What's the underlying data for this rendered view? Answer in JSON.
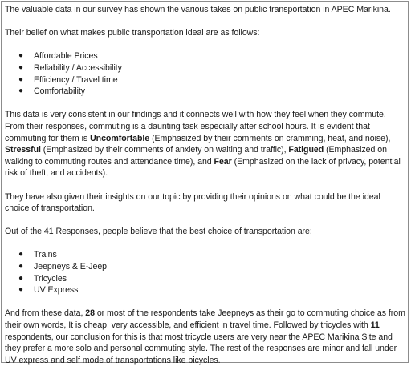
{
  "document": {
    "intro": "The valuable data in our survey has shown the various takes on public transportation in APEC Marikina.",
    "ideal_heading": "Their belief on what makes public transportation ideal are as follows:",
    "ideal_items": [
      "Affordable Prices",
      "Reliability / Accessibility",
      "Efficiency / Travel time",
      "Comfortability"
    ],
    "p3": {
      "a": "This data is very consistent in our findings and it connects well with how they feel when they commute. From their responses, commuting is a daunting task especially after school hours. It is evident that commuting for them is ",
      "b1": "Uncomfortable",
      "c": " (Emphasized by their comments on cramming, heat, and noise), ",
      "b2": "Stressful",
      "d": " (Emphasized by their comments of anxiety on waiting and traffic), ",
      "b3": "Fatigued",
      "e": " (Emphasized on walking to commuting routes and attendance time), and ",
      "b4": "Fear",
      "f": " (Emphasized on the lack of privacy, potential risk of theft, and accidents)."
    },
    "p4": "They have also given their insights on our topic by providing their opinions on what could be the ideal choice of transportation.",
    "p5": "Out of the 41 Responses, people believe that the best choice of transportation are:",
    "transport_items": [
      "Trains",
      "Jeepneys & E-Jeep",
      "Tricycles",
      "UV Express"
    ],
    "p6": {
      "a": "And from these data, ",
      "b1": "28",
      "c": " or most of the respondents take Jeepneys as their go to commuting choice as from their own words, It is cheap, very accessible, and efficient in travel time. Followed by tricycles with ",
      "b2": "11",
      "d": " respondents, our conclusion for this is that most tricycle users are very near the APEC Marikina Site and they prefer a more solo and personal commuting style. The rest of the responses are minor and fall under UV express and self mode of transportations like bicycles."
    },
    "bullet_glyph": "●"
  }
}
